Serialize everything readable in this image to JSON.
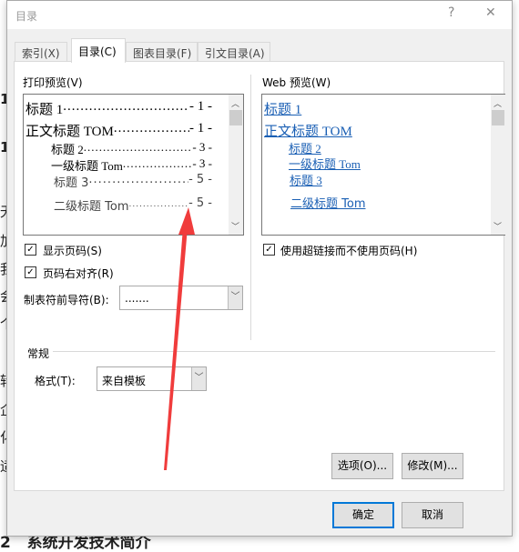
{
  "background_doc": {
    "left_chars": [
      "1",
      "1",
      "无",
      "加",
      "我",
      "会",
      "个",
      "转",
      "企",
      "化",
      "适"
    ],
    "bottom_heading": "2   系统开发技术简介"
  },
  "dialog": {
    "title": "目录",
    "help_icon": "?",
    "close_icon": "✕",
    "tabs": [
      {
        "label": "索引(X)",
        "active": false
      },
      {
        "label": "目录(C)",
        "active": true
      },
      {
        "label": "图表目录(F)",
        "active": false
      },
      {
        "label": "引文目录(A)",
        "active": false
      }
    ],
    "print_preview": {
      "label": "打印预览(V)",
      "entries": [
        {
          "text": "标题  1",
          "page": "- 1 -"
        },
        {
          "text": "正文标题 TOM",
          "page": "- 1 -"
        },
        {
          "text": "标题  2",
          "page": "- 3 -"
        },
        {
          "text": "一级标题 Tom",
          "page": "- 3 -"
        },
        {
          "text": "标题  3",
          "page": "- 5 -"
        },
        {
          "text": "二级标题 Tom",
          "page": "- 5 -"
        }
      ]
    },
    "web_preview": {
      "label": "Web 预览(W)",
      "links": [
        "标题  1",
        "正文标题 TOM",
        "标题  2",
        "一级标题 Tom",
        "标题  3",
        "二级标题 Tom"
      ],
      "link_color": "#1a5fb4"
    },
    "show_page_numbers": {
      "label": "显示页码(S)",
      "checked": true
    },
    "right_align": {
      "label": "页码右对齐(R)",
      "checked": true
    },
    "tab_leader": {
      "label": "制表符前导符(B):",
      "value": "......."
    },
    "use_hyperlinks": {
      "label": "使用超链接而不使用页码(H)",
      "checked": true
    },
    "general": {
      "label": "常规",
      "format_label": "格式(T):",
      "format_value": "来自模板"
    },
    "options_button": "选项(O)...",
    "modify_button": "修改(M)...",
    "ok_button": "确定",
    "cancel_button": "取消",
    "annotation_arrow_color": "#f03c3c"
  }
}
